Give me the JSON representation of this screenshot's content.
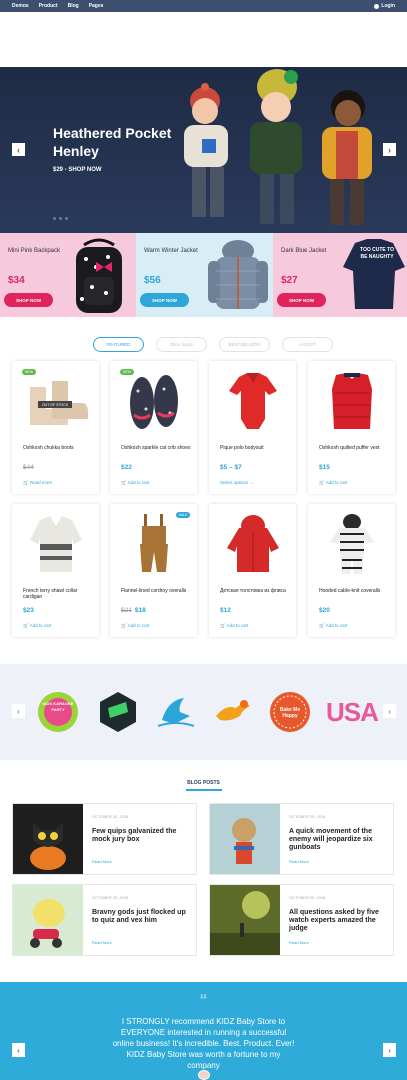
{
  "topbar": {
    "nav": [
      "Demos",
      "Product",
      "Blog",
      "Pages"
    ],
    "login": "Login"
  },
  "hero": {
    "title": "Heathered Pocket Henley",
    "subtitle": "$29 - SHOP NOW",
    "prev": "‹",
    "next": "›"
  },
  "promos": [
    {
      "title": "Mini Pink Backpack",
      "price": "$34",
      "button": "SHOP NOW",
      "price_color": "#e0245e"
    },
    {
      "title": "Warm Winter Jacket",
      "price": "$56",
      "button": "SHOP NOW",
      "price_color": "#2fa6d9"
    },
    {
      "title": "Dark Blue Jacket",
      "price": "$27",
      "button": "SHOP NOW",
      "price_color": "#e0245e",
      "shirt_text": "TOO CUTE TO BE NAUGHTY"
    }
  ],
  "tabs": [
    "FEATURED",
    "ON A SALE",
    "BESTSELLERS",
    "LATEST"
  ],
  "products": [
    {
      "name": "Oshkosh chukka boots",
      "price": "$44",
      "old": "",
      "action": "Read more",
      "badge": "NEW",
      "oos": "OUT OF STOCK",
      "strike": true
    },
    {
      "name": "Oshkosh sparkle cat crib shoes",
      "price": "$22",
      "old": "",
      "action": "Add to cart",
      "badge": "NEW",
      "oos": "",
      "strike": false
    },
    {
      "name": "Pique polo bodysuit",
      "price": "$5 – $7",
      "old": "",
      "action": "Select options →",
      "badge": "",
      "oos": "",
      "strike": false
    },
    {
      "name": "Oshkosh quilted puffer vest",
      "price": "$15",
      "old": "",
      "action": "Add to cart",
      "badge": "",
      "oos": "",
      "strike": false
    },
    {
      "name": "French terry shawl collar cardigan",
      "price": "$23",
      "old": "",
      "action": "Add to cart",
      "badge": "",
      "oos": "",
      "strike": false
    },
    {
      "name": "Flannel-lined cordroy overalls",
      "price": "$18",
      "old": "$21",
      "action": "Add to cart",
      "badge": "SALE",
      "oos": "",
      "strike": false
    },
    {
      "name": "Детская толстовка из флиса",
      "price": "$12",
      "old": "",
      "action": "Add to cart",
      "badge": "",
      "oos": "",
      "strike": false
    },
    {
      "name": "Hooded cable-knit coveralls",
      "price": "$20",
      "old": "",
      "action": "Add to cart",
      "badge": "",
      "oos": "",
      "strike": false
    }
  ],
  "brands": {
    "prev": "‹",
    "next": "›",
    "logos": [
      "KIDS KARAOKE PARTY",
      "green-cube-logo",
      "pelican-logo",
      "runner-logo",
      "Bake Me Happy",
      "USA"
    ]
  },
  "blog": {
    "heading": "BLOG POSTS",
    "posts": [
      {
        "date": "OCTOBER 20, 2016",
        "title": "Few quips galvanized the mock jury box",
        "read": "Read More"
      },
      {
        "date": "OCTOBER 20, 2016",
        "title": "A quick movement of the enemy will jeopardize six gunboats",
        "read": "Read More"
      },
      {
        "date": "OCTOBER 20, 2016",
        "title": "Bravny gods just flocked up to quiz and vex him",
        "read": "Read More"
      },
      {
        "date": "OCTOBER 20, 2016",
        "title": "All questions asked by five watch experts amazed the judge",
        "read": "Read More"
      }
    ]
  },
  "testimonial": {
    "quote_mark": "“",
    "text": "I STRONGLY recommend KIDZ Baby Store to EVERYONE interested in running a successful online business! It's incredible. Best. Product. Ever! KIDZ Baby Store was worth a fortune to my company",
    "prev": "‹",
    "next": "›"
  },
  "colors": {
    "accent": "#2fa6d9",
    "pink": "#e0245e",
    "nav_bg": "#3d4f6e"
  }
}
